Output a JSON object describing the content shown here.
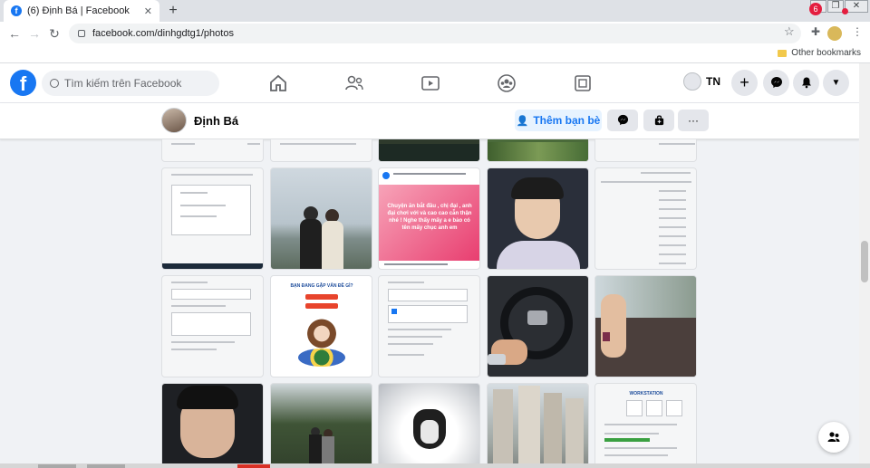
{
  "browser": {
    "tab_title": "(6) Định Bá | Facebook",
    "tab_close": "✕",
    "new_tab": "+",
    "url": "facebook.com/dinhgdtg1/photos",
    "bookmarks_other": "Other bookmarks"
  },
  "facebook": {
    "logo_letter": "f",
    "search_placeholder": "Tìm kiếm trên Facebook",
    "profile_short": "TN",
    "notifications_count": "6",
    "accent": "#1877f2"
  },
  "profile": {
    "name": "Định Bá",
    "add_friend_label": "Thêm bạn bè",
    "more_label": "···"
  },
  "photos": {
    "meme_text": "Chuyện ăn bắt đầu , chị đại , anh đại chơi với và cao cao cẵn thận nhé ! Nghe thấy mấy a e bảo có tên mấy chục anh em",
    "card_heading": "BẠN ĐANG GẶP VẤN ĐỀ GÌ?",
    "workstation_label": "WORKSTATION"
  }
}
